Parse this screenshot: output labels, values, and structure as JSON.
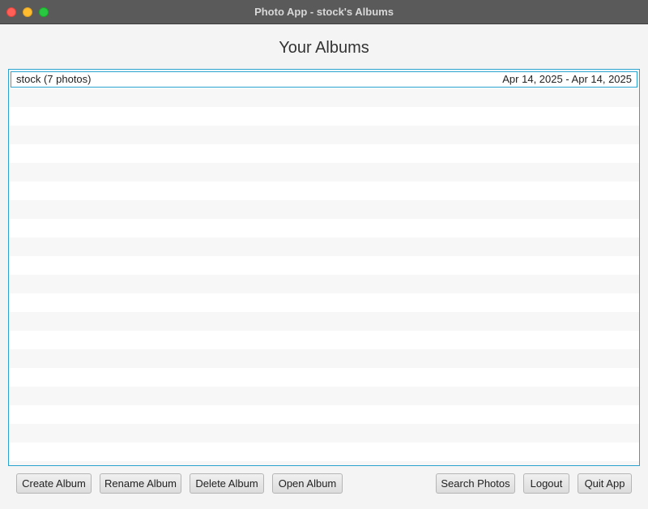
{
  "window": {
    "title": "Photo App - stock's Albums"
  },
  "heading": "Your Albums",
  "albums": [
    {
      "name": "stock (7 photos)",
      "dates": "Apr 14, 2025 - Apr 14, 2025"
    }
  ],
  "buttons": {
    "create": "Create Album",
    "rename": "Rename Album",
    "delete": "Delete Album",
    "open": "Open Album",
    "search": "Search Photos",
    "logout": "Logout",
    "quit": "Quit App"
  },
  "colors": {
    "accent": "#2aa3cf",
    "titlebar": "#5a5a5a"
  }
}
